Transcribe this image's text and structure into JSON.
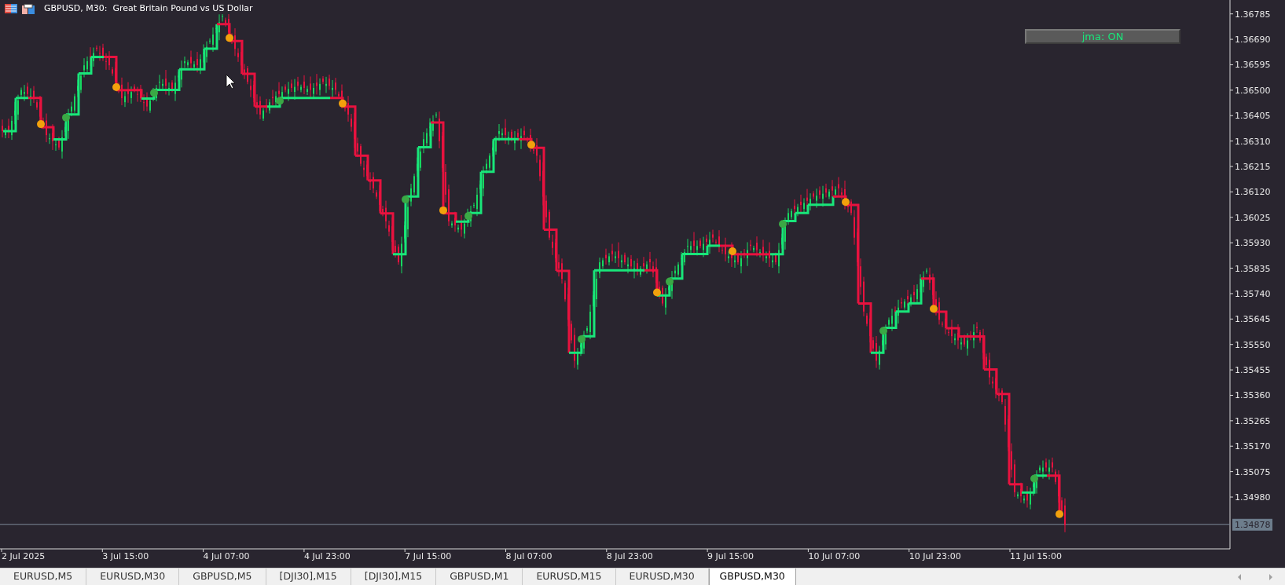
{
  "chart_header": {
    "title": "GBPUSD, M30:  Great Britain Pound vs US Dollar"
  },
  "indicator_label": {
    "text": "jma: ON"
  },
  "price_axis": {
    "labels": [
      "1.36785",
      "1.36690",
      "1.36595",
      "1.36500",
      "1.36405",
      "1.36310",
      "1.36215",
      "1.36120",
      "1.36025",
      "1.35930",
      "1.35835",
      "1.35740",
      "1.35645",
      "1.35550",
      "1.35455",
      "1.35360",
      "1.35265",
      "1.35170",
      "1.35075",
      "1.34980"
    ]
  },
  "time_axis": {
    "labels": [
      "2 Jul 2025",
      "3 Jul 15:00",
      "4 Jul 07:00",
      "4 Jul 23:00",
      "7 Jul 15:00",
      "8 Jul 07:00",
      "8 Jul 23:00",
      "9 Jul 15:00",
      "10 Jul 07:00",
      "10 Jul 23:00",
      "11 Jul 15:00"
    ]
  },
  "current_price": {
    "label": "1.34878"
  },
  "tabs": [
    {
      "label": "EURUSD,M5",
      "selected": false
    },
    {
      "label": "EURUSD,M30",
      "selected": false
    },
    {
      "label": "GBPUSD,M5",
      "selected": false
    },
    {
      "label": "[DJI30],M15",
      "selected": false
    },
    {
      "label": "[DJI30],M15",
      "selected": false
    },
    {
      "label": "GBPUSD,M1",
      "selected": false
    },
    {
      "label": "EURUSD,M15",
      "selected": false
    },
    {
      "label": "EURUSD,M30",
      "selected": false
    },
    {
      "label": "GBPUSD,M30",
      "selected": true
    }
  ]
}
